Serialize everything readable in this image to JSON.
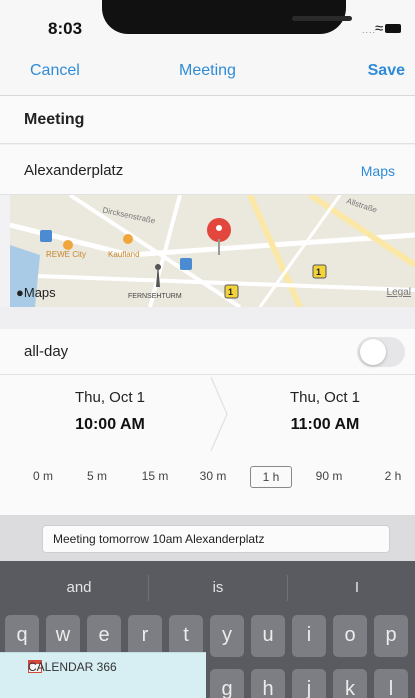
{
  "status_bar": {
    "time": "8:03"
  },
  "nav": {
    "cancel": "Cancel",
    "title": "Meeting",
    "save": "Save"
  },
  "form": {
    "title": "Meeting",
    "location": "Alexanderplatz",
    "maps_link": "Maps",
    "all_day_label": "all-day",
    "all_day_on": false
  },
  "map": {
    "logo": "Maps",
    "legal": "Legal",
    "street_1": "Dircksenstraße",
    "street_2": "Allstraße",
    "poi_1": "REWE City",
    "poi_2": "Kaufland",
    "poi_3": "FERNSEHTURM",
    "transit_badge": "1"
  },
  "schedule": {
    "start_date": "Thu, Oct 1",
    "start_time": "10:00 AM",
    "end_date": "Thu, Oct 1",
    "end_time": "11:00 AM"
  },
  "durations": {
    "options": [
      "0 m",
      "5 m",
      "15 m",
      "30 m",
      "1 h",
      "90 m",
      "2 h"
    ],
    "selected": "1 h"
  },
  "suggestion": {
    "text": "Meeting tomorrow 10am Alexanderplatz"
  },
  "keyboard": {
    "predictions": [
      "and",
      "is",
      "I"
    ],
    "row1": [
      "q",
      "w",
      "e",
      "r",
      "t",
      "y",
      "u",
      "i",
      "o",
      "p"
    ],
    "row2": [
      "g",
      "h",
      "j",
      "k",
      "l"
    ]
  },
  "banner": {
    "text": "CALENDAR 366"
  },
  "colors": {
    "accent": "#2f8bd6",
    "pin": "#e2463c",
    "keyboard": "#595b60"
  }
}
